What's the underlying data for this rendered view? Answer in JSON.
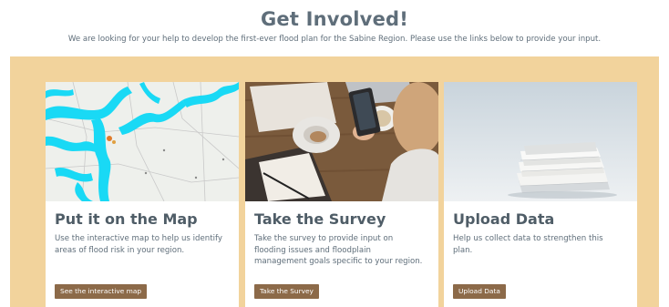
{
  "header": {
    "title": "Get Involved!",
    "subtitle": "We are looking for your help to develop the first-ever flood plan for the Sabine Region. Please use the links below to provide your input."
  },
  "colors": {
    "band": "#f2d39c",
    "button": "#8c6a49",
    "heading": "#5f6e7a",
    "floodplain": "#19d9f5"
  },
  "cards": [
    {
      "image_icon": "flood-map-image",
      "title": "Put it on the Map",
      "description": "Use the interactive map to help us identify areas of flood risk in your region.",
      "button": "See the interactive map"
    },
    {
      "image_icon": "survey-photo",
      "title": "Take the Survey",
      "description": "Take the survey to provide input on flooding issues and floodplain management goals specific to your region.",
      "button": "Take the Survey"
    },
    {
      "image_icon": "documents-photo",
      "title": "Upload Data",
      "description": "Help us collect data to strengthen this plan.",
      "button": "Upload Data"
    }
  ]
}
